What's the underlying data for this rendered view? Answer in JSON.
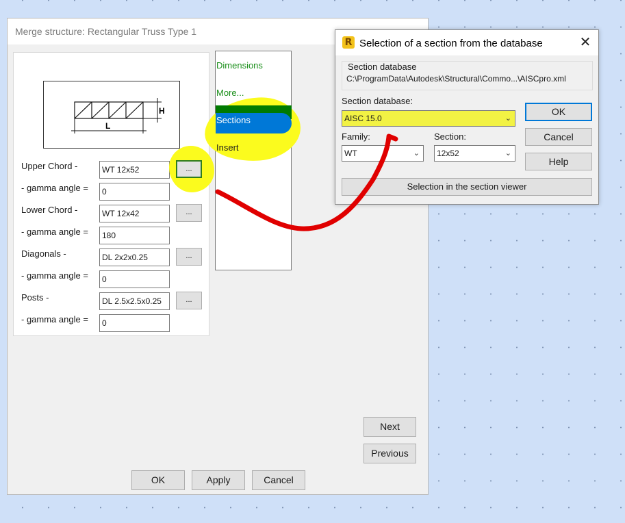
{
  "main_dialog": {
    "title": "Merge structure: Rectangular Truss Type 1",
    "figure": {
      "h_label": "H",
      "l_label": "L"
    },
    "fields": {
      "upper_chord": {
        "label": "Upper Chord -",
        "value": "WT 12x52"
      },
      "upper_gamma": {
        "label": "- gamma angle =",
        "value": "0"
      },
      "lower_chord": {
        "label": "Lower Chord -",
        "value": "WT 12x42"
      },
      "lower_gamma": {
        "label": "- gamma angle =",
        "value": "180"
      },
      "diagonals": {
        "label": "Diagonals -",
        "value": "DL 2x2x0.25"
      },
      "diagonals_gamma": {
        "label": "- gamma angle =",
        "value": "0"
      },
      "posts": {
        "label": "Posts -",
        "value": "DL 2.5x2.5x0.25"
      },
      "posts_gamma": {
        "label": "- gamma angle =",
        "value": "0"
      }
    },
    "browse_label": "...",
    "nav": {
      "dimensions": "Dimensions",
      "more": "More...",
      "sections": "Sections",
      "insert": "Insert"
    },
    "buttons": {
      "next": "Next",
      "previous": "Previous",
      "ok": "OK",
      "apply": "Apply",
      "cancel": "Cancel"
    }
  },
  "selection_dialog": {
    "title": "Selection of a section from the database",
    "icon_letter": "R",
    "close_glyph": "✕",
    "db_group_label": "Section database",
    "db_path": "C:\\ProgramData\\Autodesk\\Structural\\Commo...\\AISCpro.xml",
    "db_label": "Section database:",
    "db_value": "AISC 15.0",
    "family_label": "Family:",
    "family_value": "WT",
    "section_label": "Section:",
    "section_value": "12x52",
    "buttons": {
      "ok": "OK",
      "cancel": "Cancel",
      "help": "Help",
      "viewer": "Selection in the section viewer"
    }
  },
  "annotation_colors": {
    "highlight": "#fbfb1e",
    "arrow": "#e00000"
  },
  "ui_colors": {
    "nav_green": "#1a8f1a",
    "nav_selected": "#0078d7"
  }
}
